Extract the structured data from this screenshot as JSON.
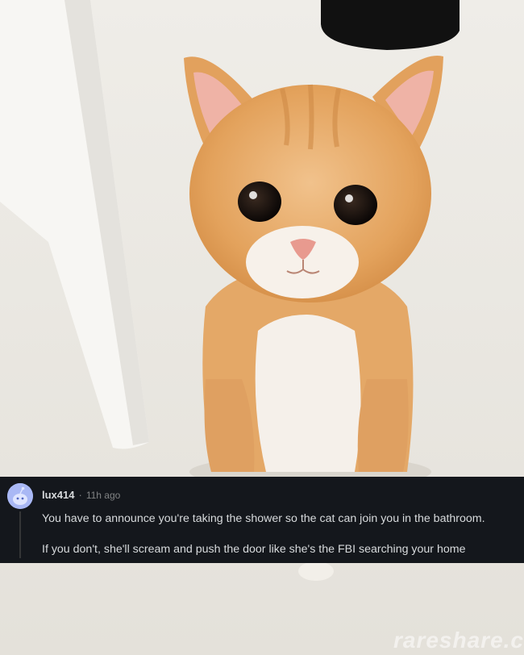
{
  "comment": {
    "username": "lux414",
    "separator": "·",
    "timestamp": "11h ago",
    "paragraphs": [
      "You have to announce you're taking the shower so the cat can join you in the bathroom.",
      "If you don't, she'll scream and push the door like she's the FBI searching your home"
    ]
  },
  "watermark": "rareshare.c",
  "colors": {
    "comment_background": "#14171c",
    "text": "#d7dadc",
    "muted_text": "#818384",
    "avatar": "#a9b8f5"
  }
}
